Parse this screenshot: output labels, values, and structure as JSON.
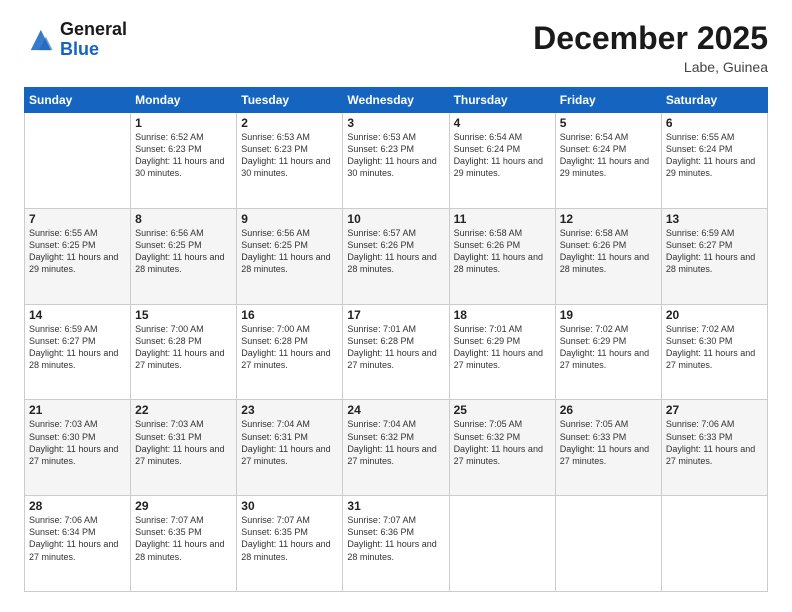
{
  "header": {
    "logo_line1": "General",
    "logo_line2": "Blue",
    "month_title": "December 2025",
    "location": "Labe, Guinea"
  },
  "days_of_week": [
    "Sunday",
    "Monday",
    "Tuesday",
    "Wednesday",
    "Thursday",
    "Friday",
    "Saturday"
  ],
  "weeks": [
    [
      {
        "day": "",
        "sunrise": "",
        "sunset": "",
        "daylight": ""
      },
      {
        "day": "1",
        "sunrise": "Sunrise: 6:52 AM",
        "sunset": "Sunset: 6:23 PM",
        "daylight": "Daylight: 11 hours and 30 minutes."
      },
      {
        "day": "2",
        "sunrise": "Sunrise: 6:53 AM",
        "sunset": "Sunset: 6:23 PM",
        "daylight": "Daylight: 11 hours and 30 minutes."
      },
      {
        "day": "3",
        "sunrise": "Sunrise: 6:53 AM",
        "sunset": "Sunset: 6:23 PM",
        "daylight": "Daylight: 11 hours and 30 minutes."
      },
      {
        "day": "4",
        "sunrise": "Sunrise: 6:54 AM",
        "sunset": "Sunset: 6:24 PM",
        "daylight": "Daylight: 11 hours and 29 minutes."
      },
      {
        "day": "5",
        "sunrise": "Sunrise: 6:54 AM",
        "sunset": "Sunset: 6:24 PM",
        "daylight": "Daylight: 11 hours and 29 minutes."
      },
      {
        "day": "6",
        "sunrise": "Sunrise: 6:55 AM",
        "sunset": "Sunset: 6:24 PM",
        "daylight": "Daylight: 11 hours and 29 minutes."
      }
    ],
    [
      {
        "day": "7",
        "sunrise": "Sunrise: 6:55 AM",
        "sunset": "Sunset: 6:25 PM",
        "daylight": "Daylight: 11 hours and 29 minutes."
      },
      {
        "day": "8",
        "sunrise": "Sunrise: 6:56 AM",
        "sunset": "Sunset: 6:25 PM",
        "daylight": "Daylight: 11 hours and 28 minutes."
      },
      {
        "day": "9",
        "sunrise": "Sunrise: 6:56 AM",
        "sunset": "Sunset: 6:25 PM",
        "daylight": "Daylight: 11 hours and 28 minutes."
      },
      {
        "day": "10",
        "sunrise": "Sunrise: 6:57 AM",
        "sunset": "Sunset: 6:26 PM",
        "daylight": "Daylight: 11 hours and 28 minutes."
      },
      {
        "day": "11",
        "sunrise": "Sunrise: 6:58 AM",
        "sunset": "Sunset: 6:26 PM",
        "daylight": "Daylight: 11 hours and 28 minutes."
      },
      {
        "day": "12",
        "sunrise": "Sunrise: 6:58 AM",
        "sunset": "Sunset: 6:26 PM",
        "daylight": "Daylight: 11 hours and 28 minutes."
      },
      {
        "day": "13",
        "sunrise": "Sunrise: 6:59 AM",
        "sunset": "Sunset: 6:27 PM",
        "daylight": "Daylight: 11 hours and 28 minutes."
      }
    ],
    [
      {
        "day": "14",
        "sunrise": "Sunrise: 6:59 AM",
        "sunset": "Sunset: 6:27 PM",
        "daylight": "Daylight: 11 hours and 28 minutes."
      },
      {
        "day": "15",
        "sunrise": "Sunrise: 7:00 AM",
        "sunset": "Sunset: 6:28 PM",
        "daylight": "Daylight: 11 hours and 27 minutes."
      },
      {
        "day": "16",
        "sunrise": "Sunrise: 7:00 AM",
        "sunset": "Sunset: 6:28 PM",
        "daylight": "Daylight: 11 hours and 27 minutes."
      },
      {
        "day": "17",
        "sunrise": "Sunrise: 7:01 AM",
        "sunset": "Sunset: 6:28 PM",
        "daylight": "Daylight: 11 hours and 27 minutes."
      },
      {
        "day": "18",
        "sunrise": "Sunrise: 7:01 AM",
        "sunset": "Sunset: 6:29 PM",
        "daylight": "Daylight: 11 hours and 27 minutes."
      },
      {
        "day": "19",
        "sunrise": "Sunrise: 7:02 AM",
        "sunset": "Sunset: 6:29 PM",
        "daylight": "Daylight: 11 hours and 27 minutes."
      },
      {
        "day": "20",
        "sunrise": "Sunrise: 7:02 AM",
        "sunset": "Sunset: 6:30 PM",
        "daylight": "Daylight: 11 hours and 27 minutes."
      }
    ],
    [
      {
        "day": "21",
        "sunrise": "Sunrise: 7:03 AM",
        "sunset": "Sunset: 6:30 PM",
        "daylight": "Daylight: 11 hours and 27 minutes."
      },
      {
        "day": "22",
        "sunrise": "Sunrise: 7:03 AM",
        "sunset": "Sunset: 6:31 PM",
        "daylight": "Daylight: 11 hours and 27 minutes."
      },
      {
        "day": "23",
        "sunrise": "Sunrise: 7:04 AM",
        "sunset": "Sunset: 6:31 PM",
        "daylight": "Daylight: 11 hours and 27 minutes."
      },
      {
        "day": "24",
        "sunrise": "Sunrise: 7:04 AM",
        "sunset": "Sunset: 6:32 PM",
        "daylight": "Daylight: 11 hours and 27 minutes."
      },
      {
        "day": "25",
        "sunrise": "Sunrise: 7:05 AM",
        "sunset": "Sunset: 6:32 PM",
        "daylight": "Daylight: 11 hours and 27 minutes."
      },
      {
        "day": "26",
        "sunrise": "Sunrise: 7:05 AM",
        "sunset": "Sunset: 6:33 PM",
        "daylight": "Daylight: 11 hours and 27 minutes."
      },
      {
        "day": "27",
        "sunrise": "Sunrise: 7:06 AM",
        "sunset": "Sunset: 6:33 PM",
        "daylight": "Daylight: 11 hours and 27 minutes."
      }
    ],
    [
      {
        "day": "28",
        "sunrise": "Sunrise: 7:06 AM",
        "sunset": "Sunset: 6:34 PM",
        "daylight": "Daylight: 11 hours and 27 minutes."
      },
      {
        "day": "29",
        "sunrise": "Sunrise: 7:07 AM",
        "sunset": "Sunset: 6:35 PM",
        "daylight": "Daylight: 11 hours and 28 minutes."
      },
      {
        "day": "30",
        "sunrise": "Sunrise: 7:07 AM",
        "sunset": "Sunset: 6:35 PM",
        "daylight": "Daylight: 11 hours and 28 minutes."
      },
      {
        "day": "31",
        "sunrise": "Sunrise: 7:07 AM",
        "sunset": "Sunset: 6:36 PM",
        "daylight": "Daylight: 11 hours and 28 minutes."
      },
      {
        "day": "",
        "sunrise": "",
        "sunset": "",
        "daylight": ""
      },
      {
        "day": "",
        "sunrise": "",
        "sunset": "",
        "daylight": ""
      },
      {
        "day": "",
        "sunrise": "",
        "sunset": "",
        "daylight": ""
      }
    ]
  ]
}
